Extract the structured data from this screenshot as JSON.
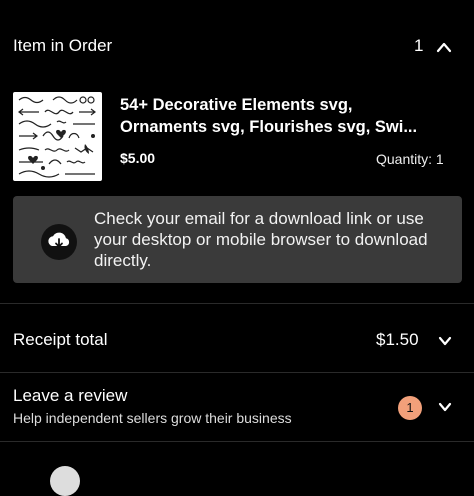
{
  "order": {
    "title": "Item in Order",
    "count": "1"
  },
  "product": {
    "name": "54+ Decorative Elements svg,\nOrnaments svg, Flourishes svg, Swi...",
    "price": "$5.00",
    "quantity": "Quantity: 1"
  },
  "notice": {
    "text": "Check your email for a download link or use your desktop or mobile browser to download directly."
  },
  "receipt": {
    "label": "Receipt total",
    "value": "$1.50"
  },
  "review": {
    "title": "Leave a review",
    "subtitle": "Help independent sellers grow their business",
    "badge": "1"
  },
  "colors": {
    "background": "#000000",
    "notice_bg": "#3a3a3a",
    "badge": "#f2a07a"
  },
  "icons": [
    "chevron-up-icon",
    "cloud-download-icon",
    "chevron-down-icon"
  ]
}
